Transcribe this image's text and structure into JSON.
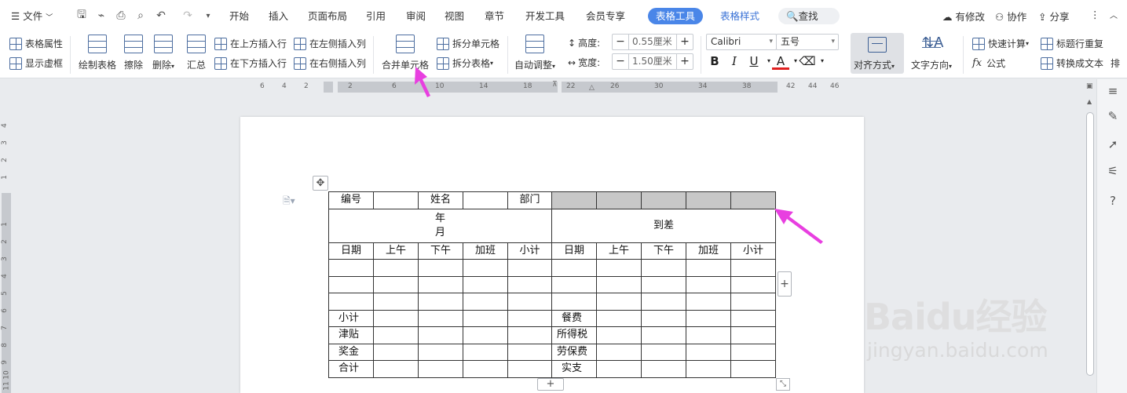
{
  "menubar": {
    "file": "文件",
    "tabs": [
      "开始",
      "插入",
      "页面布局",
      "引用",
      "审阅",
      "视图",
      "章节",
      "开发工具",
      "会员专享"
    ],
    "table_tools": "表格工具",
    "table_style": "表格样式",
    "search": "查找",
    "has_changes": "有修改",
    "collaborate": "协作",
    "share": "分享"
  },
  "ribbon": {
    "table_props": "表格属性",
    "show_gridlines": "显示虚框",
    "draw_table": "绘制表格",
    "erase": "擦除",
    "delete": "删除",
    "summary": "汇总",
    "insert_above": "在上方插入行",
    "insert_below": "在下方插入行",
    "insert_left": "在左侧插入列",
    "insert_right": "在右侧插入列",
    "merge_cells": "合并单元格",
    "split_cells": "拆分单元格",
    "split_table": "拆分表格",
    "auto_fit": "自动调整",
    "height_label": "高度:",
    "height_value": "0.55厘米",
    "width_label": "宽度:",
    "width_value": "1.50厘米",
    "font_name": "Calibri",
    "font_size": "五号",
    "alignment": "对齐方式",
    "text_direction": "文字方向",
    "quick_calc": "快速计算",
    "formula": "公式",
    "header_repeat": "标题行重复",
    "convert_text": "转换成文本",
    "more": "排"
  },
  "ruler": {
    "h_numbers": [
      "6",
      "4",
      "2",
      "2",
      "6",
      "10",
      "14",
      "18",
      "22",
      "26",
      "30",
      "34",
      "38",
      "42",
      "44",
      "46"
    ],
    "v_numbers": [
      "4",
      "3",
      "2",
      "1",
      "1",
      "2",
      "3",
      "4",
      "5",
      "6",
      "7",
      "8",
      "9",
      "10",
      "11",
      "12"
    ]
  },
  "table": {
    "row1": [
      "编号",
      "",
      "姓名",
      "",
      "部门"
    ],
    "row2_left": "年月",
    "row2_right": "到差",
    "header": [
      "日期",
      "上午",
      "下午",
      "加班",
      "小计",
      "日期",
      "上午",
      "下午",
      "加班",
      "小计"
    ],
    "left_labels": [
      "小计",
      "津贴",
      "奖金",
      "合计"
    ],
    "right_labels": [
      "餐费",
      "所得税",
      "劳保费",
      "实支"
    ]
  },
  "colors": {
    "accent": "#4a86e8",
    "arrow": "#e83fe0",
    "selection": "#c8c8c8"
  },
  "watermark": {
    "logo": "Baidu经验",
    "url": "jingyan.baidu.com"
  }
}
